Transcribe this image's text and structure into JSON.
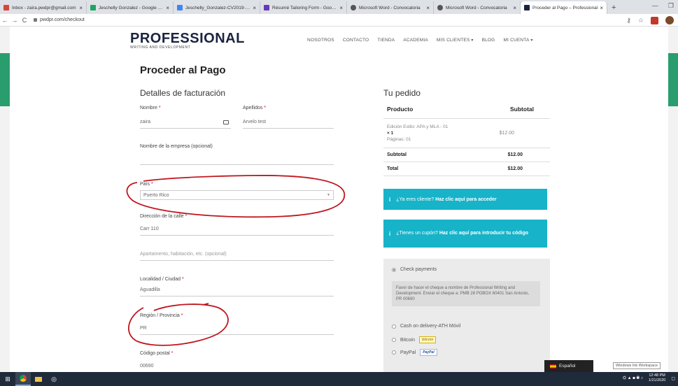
{
  "browser": {
    "tabs": [
      {
        "label": "Inbox - zaira.pwdpr@gmail.com",
        "color": "#d44638"
      },
      {
        "label": "Jeschelly Gonzalez - Google Drive",
        "color": "#1fa463"
      },
      {
        "label": "Jeschelly_Gonzalez-CV2019-Adm",
        "color": "#4285f4"
      },
      {
        "label": "Résumé Tailoring Form - Google",
        "color": "#673ab7"
      },
      {
        "label": "Microsoft Word - Convocatoria",
        "color": "#555555"
      },
      {
        "label": "Microsoft Word - Convocatoria",
        "color": "#555555"
      },
      {
        "label": "Proceder al Pago – Professional",
        "color": "#1a2340"
      }
    ],
    "new_tab": "+",
    "url": "pwdpr.com/checkout"
  },
  "site": {
    "logo_main": "PROFESSIONAL",
    "logo_sub": "WRITING AND DEVELOPMENT",
    "nav": [
      "NOSOTROS",
      "CONTACTO",
      "TIENDA",
      "ACADEMIA",
      "MIS CLIENTES",
      "BLOG",
      "MI CUENTA"
    ]
  },
  "page_title": "Proceder al Pago",
  "billing": {
    "title": "Detalles de facturación",
    "nombre_label": "Nombre",
    "nombre_value": "zaira",
    "apellidos_label": "Apellidos",
    "apellidos_value": "Arvelo test",
    "empresa_label": "Nombre de la empresa (opcional)",
    "pais_label": "País",
    "pais_value": "Puerto Rico",
    "calle_label": "Dirección de la calle",
    "calle_value": "Carr 110",
    "apartamento_placeholder": "Apartamento, habitación, etc. (opcional)",
    "ciudad_label": "Localidad / Ciudad",
    "ciudad_value": "Aguadilla",
    "region_label": "Región / Provincia",
    "region_value": "PR",
    "postal_label": "Código postal",
    "postal_value": "00690",
    "required_mark": "*"
  },
  "order": {
    "title": "Tu pedido",
    "col_product": "Producto",
    "col_subtotal": "Subtotal",
    "item_name": "Edición Estilo: APA y MLA - 01",
    "item_qty": "× 1",
    "item_pages": "Páginas: 01",
    "item_price": "$12.00",
    "subtotal_label": "Subtotal",
    "subtotal_value": "$12.00",
    "total_label": "Total",
    "total_value": "$12.00"
  },
  "notices": {
    "login_text": "¿Ya eres cliente?",
    "login_link": "Haz clic aquí para acceder",
    "coupon_text": "¿Tienes un cupón?",
    "coupon_link": "Haz clic aquí para introducir tu código"
  },
  "payment": {
    "check_label": "Check payments",
    "check_desc": "Favor de hacer el cheque a nombre de Professional Writing and Development. Enviar el cheque a: PMB 28 POBOX 60401 San Antonio, PR 00690",
    "cod_label": "Cash on delivery-ATH Móvil",
    "bitcoin_label": "Bitcoin",
    "bitcoin_badge": "bitcoin",
    "paypal_label": "PayPal",
    "paypal_badge": "PayPal"
  },
  "language_chip": "Español",
  "ink_workspace": "Windows Ink Workspace",
  "taskbar": {
    "time": "12:48 PM",
    "date": "1/21/2020"
  },
  "colors": {
    "accent": "#17b3c9",
    "brand": "#1a2340",
    "annotation": "#c0161e",
    "green": "#2a9d6f"
  }
}
